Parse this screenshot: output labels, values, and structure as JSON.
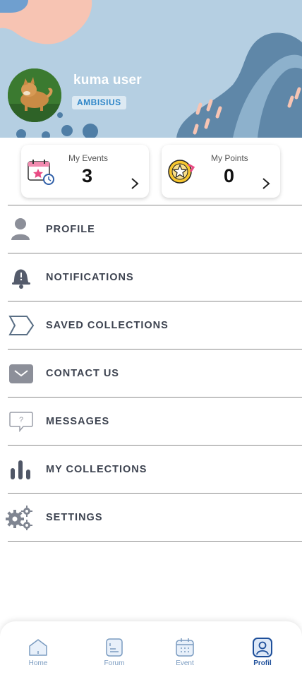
{
  "profile": {
    "username": "kuma user",
    "badge": "AMBISIUS"
  },
  "stats": {
    "events": {
      "label": "My Events",
      "value": "3"
    },
    "points": {
      "label": "My Points",
      "value": "0"
    }
  },
  "menu": [
    {
      "label": "PROFILE",
      "icon": "person-icon"
    },
    {
      "label": "NOTIFICATIONS",
      "icon": "bell-icon"
    },
    {
      "label": "SAVED COLLECTIONS",
      "icon": "tag-icon"
    },
    {
      "label": "CONTACT US",
      "icon": "mail-icon"
    },
    {
      "label": "MESSAGES",
      "icon": "question-bubble-icon"
    },
    {
      "label": "MY COLLECTIONS",
      "icon": "bar-chart-icon"
    },
    {
      "label": "SETTINGS",
      "icon": "gears-icon"
    }
  ],
  "nav": {
    "home": "Home",
    "forum": "Forum",
    "event": "Event",
    "profil": "Profil",
    "active": "Profil"
  },
  "colors": {
    "header_bg": "#b5cfe2",
    "accent_dark": "#5f87a8",
    "accent_peach": "#f7c4b3",
    "active_nav": "#1e4f9a"
  }
}
